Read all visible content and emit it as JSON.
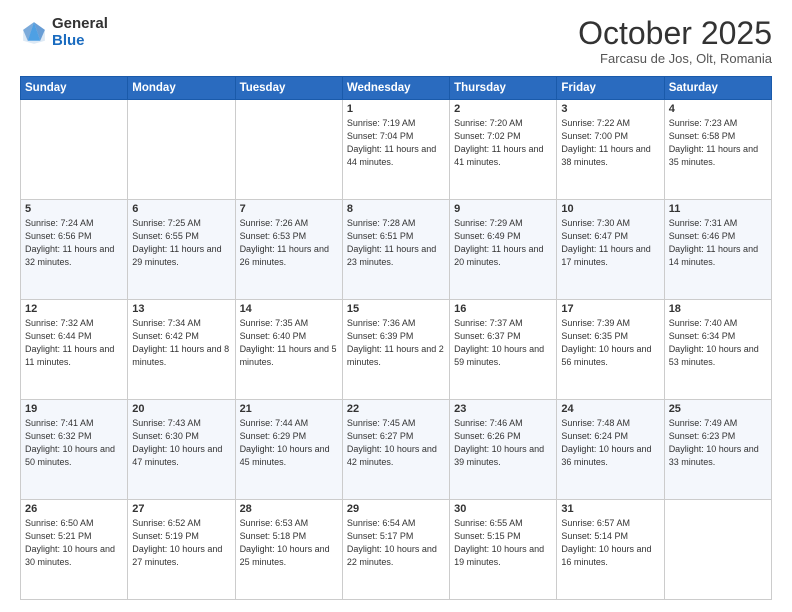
{
  "header": {
    "logo_general": "General",
    "logo_blue": "Blue",
    "month": "October 2025",
    "location": "Farcasu de Jos, Olt, Romania"
  },
  "days_of_week": [
    "Sunday",
    "Monday",
    "Tuesday",
    "Wednesday",
    "Thursday",
    "Friday",
    "Saturday"
  ],
  "weeks": [
    [
      {
        "day": "",
        "info": ""
      },
      {
        "day": "",
        "info": ""
      },
      {
        "day": "",
        "info": ""
      },
      {
        "day": "1",
        "info": "Sunrise: 7:19 AM\nSunset: 7:04 PM\nDaylight: 11 hours and 44 minutes."
      },
      {
        "day": "2",
        "info": "Sunrise: 7:20 AM\nSunset: 7:02 PM\nDaylight: 11 hours and 41 minutes."
      },
      {
        "day": "3",
        "info": "Sunrise: 7:22 AM\nSunset: 7:00 PM\nDaylight: 11 hours and 38 minutes."
      },
      {
        "day": "4",
        "info": "Sunrise: 7:23 AM\nSunset: 6:58 PM\nDaylight: 11 hours and 35 minutes."
      }
    ],
    [
      {
        "day": "5",
        "info": "Sunrise: 7:24 AM\nSunset: 6:56 PM\nDaylight: 11 hours and 32 minutes."
      },
      {
        "day": "6",
        "info": "Sunrise: 7:25 AM\nSunset: 6:55 PM\nDaylight: 11 hours and 29 minutes."
      },
      {
        "day": "7",
        "info": "Sunrise: 7:26 AM\nSunset: 6:53 PM\nDaylight: 11 hours and 26 minutes."
      },
      {
        "day": "8",
        "info": "Sunrise: 7:28 AM\nSunset: 6:51 PM\nDaylight: 11 hours and 23 minutes."
      },
      {
        "day": "9",
        "info": "Sunrise: 7:29 AM\nSunset: 6:49 PM\nDaylight: 11 hours and 20 minutes."
      },
      {
        "day": "10",
        "info": "Sunrise: 7:30 AM\nSunset: 6:47 PM\nDaylight: 11 hours and 17 minutes."
      },
      {
        "day": "11",
        "info": "Sunrise: 7:31 AM\nSunset: 6:46 PM\nDaylight: 11 hours and 14 minutes."
      }
    ],
    [
      {
        "day": "12",
        "info": "Sunrise: 7:32 AM\nSunset: 6:44 PM\nDaylight: 11 hours and 11 minutes."
      },
      {
        "day": "13",
        "info": "Sunrise: 7:34 AM\nSunset: 6:42 PM\nDaylight: 11 hours and 8 minutes."
      },
      {
        "day": "14",
        "info": "Sunrise: 7:35 AM\nSunset: 6:40 PM\nDaylight: 11 hours and 5 minutes."
      },
      {
        "day": "15",
        "info": "Sunrise: 7:36 AM\nSunset: 6:39 PM\nDaylight: 11 hours and 2 minutes."
      },
      {
        "day": "16",
        "info": "Sunrise: 7:37 AM\nSunset: 6:37 PM\nDaylight: 10 hours and 59 minutes."
      },
      {
        "day": "17",
        "info": "Sunrise: 7:39 AM\nSunset: 6:35 PM\nDaylight: 10 hours and 56 minutes."
      },
      {
        "day": "18",
        "info": "Sunrise: 7:40 AM\nSunset: 6:34 PM\nDaylight: 10 hours and 53 minutes."
      }
    ],
    [
      {
        "day": "19",
        "info": "Sunrise: 7:41 AM\nSunset: 6:32 PM\nDaylight: 10 hours and 50 minutes."
      },
      {
        "day": "20",
        "info": "Sunrise: 7:43 AM\nSunset: 6:30 PM\nDaylight: 10 hours and 47 minutes."
      },
      {
        "day": "21",
        "info": "Sunrise: 7:44 AM\nSunset: 6:29 PM\nDaylight: 10 hours and 45 minutes."
      },
      {
        "day": "22",
        "info": "Sunrise: 7:45 AM\nSunset: 6:27 PM\nDaylight: 10 hours and 42 minutes."
      },
      {
        "day": "23",
        "info": "Sunrise: 7:46 AM\nSunset: 6:26 PM\nDaylight: 10 hours and 39 minutes."
      },
      {
        "day": "24",
        "info": "Sunrise: 7:48 AM\nSunset: 6:24 PM\nDaylight: 10 hours and 36 minutes."
      },
      {
        "day": "25",
        "info": "Sunrise: 7:49 AM\nSunset: 6:23 PM\nDaylight: 10 hours and 33 minutes."
      }
    ],
    [
      {
        "day": "26",
        "info": "Sunrise: 6:50 AM\nSunset: 5:21 PM\nDaylight: 10 hours and 30 minutes."
      },
      {
        "day": "27",
        "info": "Sunrise: 6:52 AM\nSunset: 5:19 PM\nDaylight: 10 hours and 27 minutes."
      },
      {
        "day": "28",
        "info": "Sunrise: 6:53 AM\nSunset: 5:18 PM\nDaylight: 10 hours and 25 minutes."
      },
      {
        "day": "29",
        "info": "Sunrise: 6:54 AM\nSunset: 5:17 PM\nDaylight: 10 hours and 22 minutes."
      },
      {
        "day": "30",
        "info": "Sunrise: 6:55 AM\nSunset: 5:15 PM\nDaylight: 10 hours and 19 minutes."
      },
      {
        "day": "31",
        "info": "Sunrise: 6:57 AM\nSunset: 5:14 PM\nDaylight: 10 hours and 16 minutes."
      },
      {
        "day": "",
        "info": ""
      }
    ]
  ]
}
